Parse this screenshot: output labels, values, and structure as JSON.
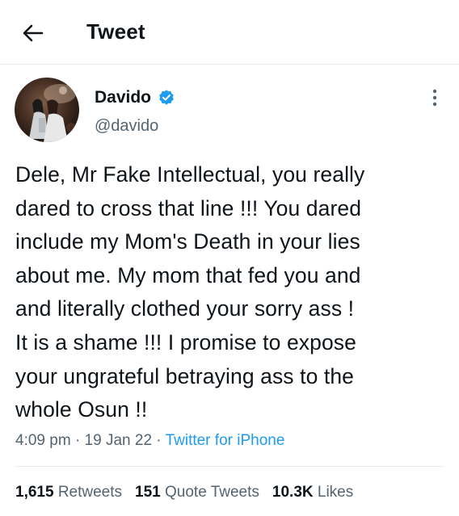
{
  "header": {
    "back_icon": "arrow-left-icon",
    "title": "Tweet"
  },
  "author": {
    "name": "Davido",
    "handle": "@davido",
    "verified": true,
    "verified_color": "#1d9bf0",
    "more_icon": "vertical-dots-icon"
  },
  "tweet": {
    "text": "Dele, Mr Fake Intellectual, you really\ndared to cross that line !!! You dared\ninclude my Mom's Death in your lies\nabout me. My mom that fed you and\nand literally clothed your sorry ass !\nIt is a shame !!! I promise to expose\nyour ungrateful betraying ass to the\nwhole Osun !!",
    "time": "4:09 pm",
    "date": "19 Jan 22",
    "source": "Twitter for iPhone",
    "separator": "·"
  },
  "stats": {
    "retweets_count": "1,615",
    "retweets_label": "Retweets",
    "quotes_count": "151",
    "quotes_label": "Quote Tweets",
    "likes_count": "10.3K",
    "likes_label": "Likes"
  },
  "colors": {
    "text_primary": "#0f1419",
    "text_secondary": "#536471",
    "accent": "#1d9bf0",
    "divider": "#e6ecf0"
  }
}
